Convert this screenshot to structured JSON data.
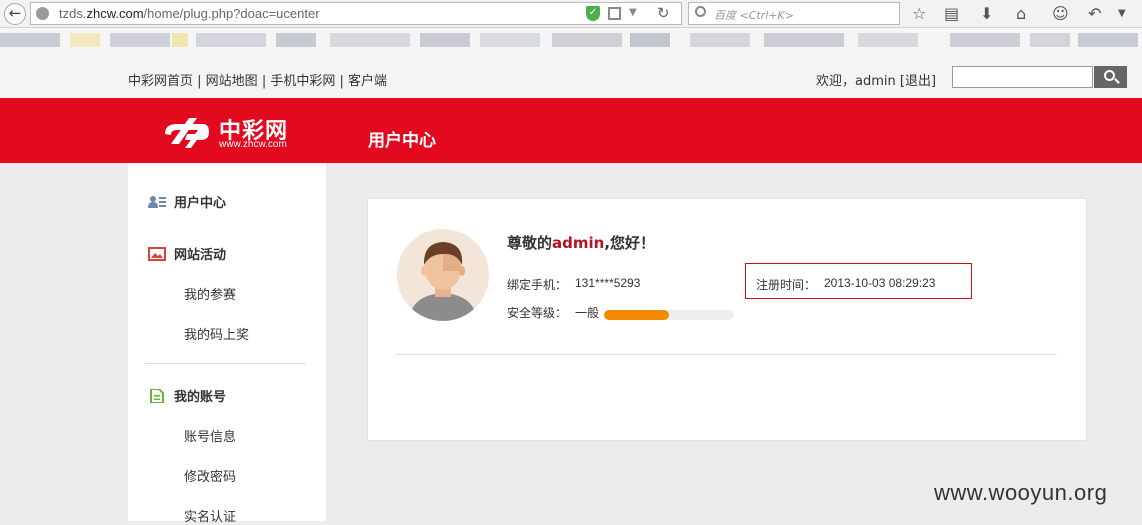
{
  "browser": {
    "url_prefix": "tzds.",
    "url_domain": "zhcw.com",
    "url_path": "/home/plug.php?doac=ucenter",
    "search_placeholder": "百度 <Ctrl+K>"
  },
  "topnav": {
    "links": [
      "中彩网首页",
      "网站地图",
      "手机中彩网",
      "客户端"
    ],
    "separator": " | ",
    "welcome_prefix": "欢迎，",
    "username": "admin",
    "logout": "[退出]"
  },
  "header": {
    "logo_cn": "中彩网",
    "logo_en": "www.zhcw.com",
    "title": "用户中心"
  },
  "sidebar": {
    "section_user": "用户中心",
    "section_activity": "网站活动",
    "item_my_contest": "我的参赛",
    "item_my_prize": "我的码上奖",
    "section_account": "我的账号",
    "item_account_info": "账号信息",
    "item_change_password": "修改密码",
    "item_real_name": "实名认证"
  },
  "profile": {
    "greet_prefix": "尊敬的",
    "greet_name": "admin",
    "greet_suffix": ",您好！",
    "phone_label": "绑定手机：",
    "phone_value": "131****5293",
    "register_label": "注册时间：",
    "register_value": "2013-10-03 08:29:23",
    "security_label": "安全等级：",
    "security_value": "一般",
    "security_level": 0.5
  },
  "watermark": "www.wooyun.org",
  "colors": {
    "brand_red": "#e30a20",
    "progress_orange": "#f28a00",
    "highlight_red": "#b5111e"
  }
}
